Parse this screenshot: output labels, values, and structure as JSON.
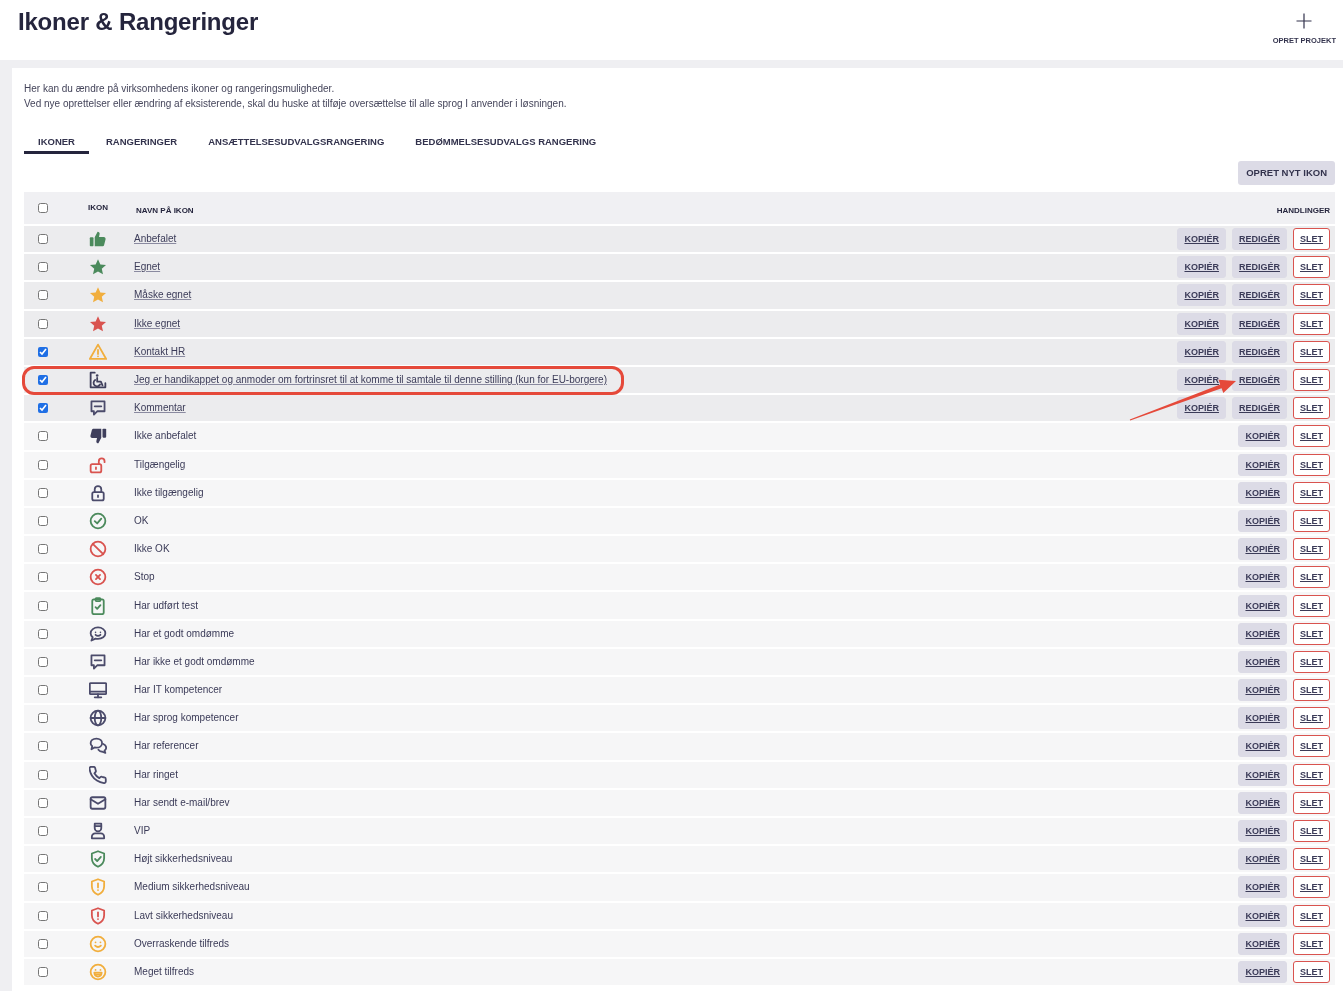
{
  "header": {
    "title": "Ikoner & Rangeringer",
    "action": {
      "label": "OPRET PROJEKT"
    }
  },
  "intro": [
    "Her kan du ændre på virksomhedens ikoner og rangeringsmuligheder.",
    "Ved nye oprettelser eller ændring af eksisterende, skal du huske at tilføje oversættelse til alle sprog I anvender i løsningen."
  ],
  "tabs": [
    {
      "label": "IKONER",
      "selected": true
    },
    {
      "label": "RANGERINGER",
      "selected": false
    },
    {
      "label": "ANSÆTTELSESUDVALGSRANGERING",
      "selected": false
    },
    {
      "label": "BEDØMMELSESUDVALGS RANGERING",
      "selected": false
    }
  ],
  "toolbar": {
    "button": "OPRET NYT IKON"
  },
  "table": {
    "select_all": {
      "checked": false
    },
    "columns": [
      "IKON",
      "NAVN PÅ IKON",
      "HANDLINGER"
    ],
    "rows": [
      {
        "checked": false,
        "icon": {
          "kind": "thumbsup",
          "color": "#4b8a5c"
        },
        "name": "Anbefalet",
        "kind": "editable",
        "highlighted": false,
        "actions": [
          {
            "label": "KOPIÉR",
            "kind": "copy"
          },
          {
            "label": "REDIGÉR",
            "kind": "edit"
          },
          {
            "label": "SLET",
            "kind": "delete"
          }
        ]
      },
      {
        "checked": false,
        "icon": {
          "kind": "star",
          "color": "#4b8a5c"
        },
        "name": "Egnet",
        "kind": "editable",
        "highlighted": false,
        "actions": [
          {
            "label": "KOPIÉR",
            "kind": "copy"
          },
          {
            "label": "REDIGÉR",
            "kind": "edit"
          },
          {
            "label": "SLET",
            "kind": "delete"
          }
        ]
      },
      {
        "checked": false,
        "icon": {
          "kind": "star",
          "color": "#f1ae3d"
        },
        "name": "Måske egnet",
        "kind": "editable",
        "highlighted": false,
        "actions": [
          {
            "label": "KOPIÉR",
            "kind": "copy"
          },
          {
            "label": "REDIGÉR",
            "kind": "edit"
          },
          {
            "label": "SLET",
            "kind": "delete"
          }
        ]
      },
      {
        "checked": false,
        "icon": {
          "kind": "star",
          "color": "#d9534f"
        },
        "name": "Ikke egnet",
        "kind": "editable",
        "highlighted": false,
        "actions": [
          {
            "label": "KOPIÉR",
            "kind": "copy"
          },
          {
            "label": "REDIGÉR",
            "kind": "edit"
          },
          {
            "label": "SLET",
            "kind": "delete"
          }
        ]
      },
      {
        "checked": true,
        "icon": {
          "kind": "warning",
          "color": "#f1ae3d"
        },
        "name": "Kontakt HR",
        "kind": "editable",
        "highlighted": false,
        "actions": [
          {
            "label": "KOPIÉR",
            "kind": "copy"
          },
          {
            "label": "REDIGÉR",
            "kind": "edit"
          },
          {
            "label": "SLET",
            "kind": "delete"
          }
        ]
      },
      {
        "checked": true,
        "icon": {
          "kind": "wheelchair",
          "color": "#3f3f5c"
        },
        "name": "Jeg er handikappet og anmoder om fortrinsret til at komme til samtale til denne stilling (kun for EU-borgere)",
        "kind": "editable",
        "highlighted": true,
        "actions": [
          {
            "label": "KOPIÉR",
            "kind": "copy"
          },
          {
            "label": "REDIGÉR",
            "kind": "edit"
          },
          {
            "label": "SLET",
            "kind": "delete"
          }
        ]
      },
      {
        "checked": true,
        "icon": {
          "kind": "comment",
          "color": "#4b4b6b"
        },
        "name": "Kommentar",
        "kind": "editable",
        "highlighted": false,
        "actions": [
          {
            "label": "KOPIÉR",
            "kind": "copy"
          },
          {
            "label": "REDIGÉR",
            "kind": "edit"
          },
          {
            "label": "SLET",
            "kind": "delete"
          }
        ]
      },
      {
        "checked": false,
        "icon": {
          "kind": "thumbsdown",
          "color": "#3f3f5c"
        },
        "name": "Ikke anbefalet",
        "kind": "standard",
        "highlighted": false,
        "actions": [
          {
            "label": "KOPIÉR",
            "kind": "copy"
          },
          {
            "label": "SLET",
            "kind": "delete"
          }
        ]
      },
      {
        "checked": false,
        "icon": {
          "kind": "unlock",
          "color": "#d9534f"
        },
        "name": "Tilgængelig",
        "kind": "standard",
        "highlighted": false,
        "actions": [
          {
            "label": "KOPIÉR",
            "kind": "copy"
          },
          {
            "label": "SLET",
            "kind": "delete"
          }
        ]
      },
      {
        "checked": false,
        "icon": {
          "kind": "lock",
          "color": "#4b4b6b"
        },
        "name": "Ikke tilgængelig",
        "kind": "standard",
        "highlighted": false,
        "actions": [
          {
            "label": "KOPIÉR",
            "kind": "copy"
          },
          {
            "label": "SLET",
            "kind": "delete"
          }
        ]
      },
      {
        "checked": false,
        "icon": {
          "kind": "checkcircle",
          "color": "#4b8a5c"
        },
        "name": "OK",
        "kind": "standard",
        "highlighted": false,
        "actions": [
          {
            "label": "KOPIÉR",
            "kind": "copy"
          },
          {
            "label": "SLET",
            "kind": "delete"
          }
        ]
      },
      {
        "checked": false,
        "icon": {
          "kind": "ban",
          "color": "#d9534f"
        },
        "name": "Ikke OK",
        "kind": "standard",
        "highlighted": false,
        "actions": [
          {
            "label": "KOPIÉR",
            "kind": "copy"
          },
          {
            "label": "SLET",
            "kind": "delete"
          }
        ]
      },
      {
        "checked": false,
        "icon": {
          "kind": "xcircle",
          "color": "#d9534f"
        },
        "name": "Stop",
        "kind": "standard",
        "highlighted": false,
        "actions": [
          {
            "label": "KOPIÉR",
            "kind": "copy"
          },
          {
            "label": "SLET",
            "kind": "delete"
          }
        ]
      },
      {
        "checked": false,
        "icon": {
          "kind": "clipboard",
          "color": "#4b8a5c"
        },
        "name": "Har udført test",
        "kind": "standard",
        "highlighted": false,
        "actions": [
          {
            "label": "KOPIÉR",
            "kind": "copy"
          },
          {
            "label": "SLET",
            "kind": "delete"
          }
        ]
      },
      {
        "checked": false,
        "icon": {
          "kind": "chatsmile",
          "color": "#4b4b6b"
        },
        "name": "Har et godt omdømme",
        "kind": "standard",
        "highlighted": false,
        "actions": [
          {
            "label": "KOPIÉR",
            "kind": "copy"
          },
          {
            "label": "SLET",
            "kind": "delete"
          }
        ]
      },
      {
        "checked": false,
        "icon": {
          "kind": "comment",
          "color": "#4b4b6b"
        },
        "name": "Har ikke et godt omdømme",
        "kind": "standard",
        "highlighted": false,
        "actions": [
          {
            "label": "KOPIÉR",
            "kind": "copy"
          },
          {
            "label": "SLET",
            "kind": "delete"
          }
        ]
      },
      {
        "checked": false,
        "icon": {
          "kind": "monitor",
          "color": "#4b4b6b"
        },
        "name": "Har IT kompetencer",
        "kind": "standard",
        "highlighted": false,
        "actions": [
          {
            "label": "KOPIÉR",
            "kind": "copy"
          },
          {
            "label": "SLET",
            "kind": "delete"
          }
        ]
      },
      {
        "checked": false,
        "icon": {
          "kind": "globe",
          "color": "#4b4b6b"
        },
        "name": "Har sprog kompetencer",
        "kind": "standard",
        "highlighted": false,
        "actions": [
          {
            "label": "KOPIÉR",
            "kind": "copy"
          },
          {
            "label": "SLET",
            "kind": "delete"
          }
        ]
      },
      {
        "checked": false,
        "icon": {
          "kind": "chats",
          "color": "#4b4b6b"
        },
        "name": "Har referencer",
        "kind": "standard",
        "highlighted": false,
        "actions": [
          {
            "label": "KOPIÉR",
            "kind": "copy"
          },
          {
            "label": "SLET",
            "kind": "delete"
          }
        ]
      },
      {
        "checked": false,
        "icon": {
          "kind": "phone",
          "color": "#4b4b6b"
        },
        "name": "Har ringet",
        "kind": "standard",
        "highlighted": false,
        "actions": [
          {
            "label": "KOPIÉR",
            "kind": "copy"
          },
          {
            "label": "SLET",
            "kind": "delete"
          }
        ]
      },
      {
        "checked": false,
        "icon": {
          "kind": "envelope",
          "color": "#4b4b6b"
        },
        "name": "Har sendt e-mail/brev",
        "kind": "standard",
        "highlighted": false,
        "actions": [
          {
            "label": "KOPIÉR",
            "kind": "copy"
          },
          {
            "label": "SLET",
            "kind": "delete"
          }
        ]
      },
      {
        "checked": false,
        "icon": {
          "kind": "person",
          "color": "#4b4b6b"
        },
        "name": "VIP",
        "kind": "standard",
        "highlighted": false,
        "actions": [
          {
            "label": "KOPIÉR",
            "kind": "copy"
          },
          {
            "label": "SLET",
            "kind": "delete"
          }
        ]
      },
      {
        "checked": false,
        "icon": {
          "kind": "shieldcheck",
          "color": "#4b8a5c"
        },
        "name": "Højt sikkerhedsniveau",
        "kind": "standard",
        "highlighted": false,
        "actions": [
          {
            "label": "KOPIÉR",
            "kind": "copy"
          },
          {
            "label": "SLET",
            "kind": "delete"
          }
        ]
      },
      {
        "checked": false,
        "icon": {
          "kind": "shieldalert",
          "color": "#f1ae3d"
        },
        "name": "Medium sikkerhedsniveau",
        "kind": "standard",
        "highlighted": false,
        "actions": [
          {
            "label": "KOPIÉR",
            "kind": "copy"
          },
          {
            "label": "SLET",
            "kind": "delete"
          }
        ]
      },
      {
        "checked": false,
        "icon": {
          "kind": "shieldalert",
          "color": "#d9534f"
        },
        "name": "Lavt sikkerhedsniveau",
        "kind": "standard",
        "highlighted": false,
        "actions": [
          {
            "label": "KOPIÉR",
            "kind": "copy"
          },
          {
            "label": "SLET",
            "kind": "delete"
          }
        ]
      },
      {
        "checked": false,
        "icon": {
          "kind": "smile",
          "color": "#f1ae3d"
        },
        "name": "Overraskende tilfreds",
        "kind": "standard",
        "highlighted": false,
        "actions": [
          {
            "label": "KOPIÉR",
            "kind": "copy"
          },
          {
            "label": "SLET",
            "kind": "delete"
          }
        ]
      },
      {
        "checked": false,
        "icon": {
          "kind": "grin",
          "color": "#f1ae3d"
        },
        "name": "Meget tilfreds",
        "kind": "standard",
        "highlighted": false,
        "actions": [
          {
            "label": "KOPIÉR",
            "kind": "copy"
          },
          {
            "label": "SLET",
            "kind": "delete"
          }
        ]
      }
    ]
  }
}
